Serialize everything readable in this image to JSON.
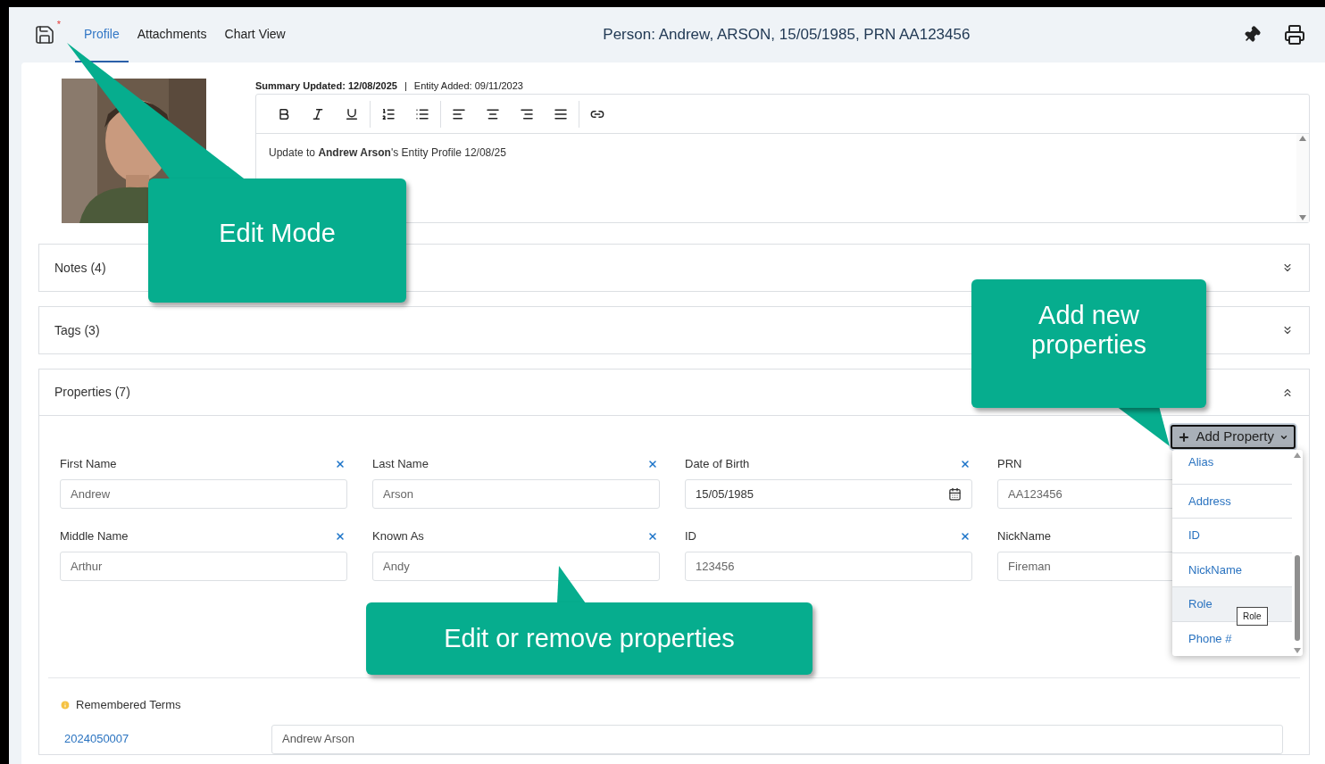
{
  "header": {
    "unsaved_mark": "*",
    "tabs": [
      {
        "label": "Profile",
        "selected": true
      },
      {
        "label": "Attachments",
        "selected": false
      },
      {
        "label": "Chart View",
        "selected": false
      }
    ],
    "title": "Person: Andrew, ARSON, 15/05/1985, PRN AA123456"
  },
  "summary": {
    "updated": "Summary Updated: 12/08/2025",
    "separator": "|",
    "added": "Entity Added: 09/11/2023",
    "editor_text": "Update to **Andrew Arson**'s Entity Profile 12/08/25"
  },
  "panels": [
    {
      "label": "Notes (4)",
      "expanded": false
    },
    {
      "label": "Tags (3)",
      "expanded": false
    },
    {
      "label": "Properties (7)",
      "expanded": true
    }
  ],
  "properties": {
    "add_button": "Add Property",
    "fields": [
      {
        "label": "First Name",
        "value": "Andrew",
        "kind": "text",
        "removable": true
      },
      {
        "label": "Last Name",
        "value": "Arson",
        "kind": "text",
        "removable": true
      },
      {
        "label": "Date of Birth",
        "value": "15/05/1985",
        "kind": "date",
        "removable": true
      },
      {
        "label": "PRN",
        "value": "AA123456",
        "kind": "text",
        "removable": false
      },
      {
        "label": "Middle Name",
        "value": "Arthur",
        "kind": "text",
        "removable": true
      },
      {
        "label": "Known As",
        "value": "Andy",
        "kind": "text",
        "removable": true
      },
      {
        "label": "ID",
        "value": "123456",
        "kind": "text",
        "removable": true
      },
      {
        "label": "NickName",
        "value": "Fireman",
        "kind": "text",
        "removable": false
      }
    ],
    "menu": [
      {
        "label": "Alias",
        "selected": false
      },
      {
        "label": "Address",
        "selected": false
      },
      {
        "label": "ID",
        "selected": false
      },
      {
        "label": "NickName",
        "selected": false
      },
      {
        "label": "Role",
        "selected": true
      },
      {
        "label": "Phone #",
        "selected": false
      }
    ],
    "tooltip": "Role"
  },
  "remembered": {
    "title": "Remembered Terms",
    "rows": [
      {
        "term": "2024050007",
        "value": "Andrew Arson"
      }
    ]
  },
  "callouts": [
    {
      "text": "Edit Mode"
    },
    {
      "text": "Add new properties"
    },
    {
      "text": "Edit or remove properties"
    }
  ]
}
